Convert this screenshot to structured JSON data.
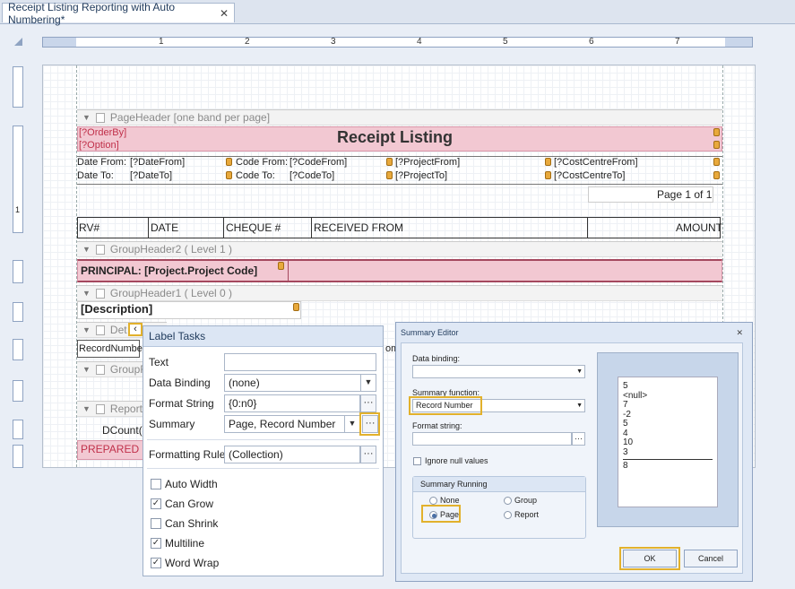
{
  "tab": {
    "title": "Receipt Listing Reporting with Auto Numbering*",
    "close": "✕"
  },
  "ruler": {
    "numbers": [
      "1",
      "2",
      "3",
      "4",
      "5",
      "6",
      "7"
    ],
    "vertical_number": "1"
  },
  "report": {
    "page_header_band": "PageHeader [one band per page]",
    "order_by": "[?OrderBy]",
    "option": "[?Option]",
    "title": "Receipt Listing",
    "date_from_label": "Date From:",
    "date_from_value": "[?DateFrom]",
    "code_from_label": "Code From:",
    "code_from_value": "[?CodeFrom]",
    "project_from": "[?ProjectFrom]",
    "cost_centre_from": "[?CostCentreFrom]",
    "date_to_label": "Date To:",
    "date_to_value": "[?DateTo]",
    "code_to_label": "Code To:",
    "code_to_value": "[?CodeTo]",
    "project_to": "[?ProjectTo]",
    "cost_centre_to": "[?CostCentreTo]",
    "page_of": "Page 1 of 1",
    "columns": [
      "RV#",
      "DATE",
      "CHEQUE #",
      "RECEIVED FROM",
      "AMOUNT"
    ],
    "group_header2_band": "GroupHeader2 ( Level 1 )",
    "principal": "PRINCIPAL: [Project.Project Code]",
    "group_header1_band": "GroupHeader1 ( Level 0 )",
    "description": "[Description]",
    "detail_band": "Det",
    "record_number": "RecordNumbe",
    "om_fragment": "om",
    "group_footer_band": "GroupF",
    "report_footer_band": "ReportF",
    "dcount": "DCount(",
    "prepared_by": "PREPARED B"
  },
  "label_tasks": {
    "title": "Label Tasks",
    "text_label": "Text",
    "text_value": "",
    "data_binding_label": "Data Binding",
    "data_binding_value": "(none)",
    "format_string_label": "Format String",
    "format_string_value": "{0:n0}",
    "summary_label": "Summary",
    "summary_value": "Page, Record Number",
    "formatting_rules_label": "Formatting Rules",
    "formatting_rules_value": "(Collection)",
    "ellipsis": "···",
    "collapse_glyph": "‹",
    "checkboxes": [
      {
        "label": "Auto Width",
        "checked": false
      },
      {
        "label": "Can Grow",
        "checked": true
      },
      {
        "label": "Can Shrink",
        "checked": false
      },
      {
        "label": "Multiline",
        "checked": true
      },
      {
        "label": "Word Wrap",
        "checked": true
      }
    ]
  },
  "summary_editor": {
    "title": "Summary Editor",
    "close": "✕",
    "data_binding_label": "Data binding:",
    "data_binding_value": "",
    "summary_function_label": "Summary function:",
    "summary_function_value": "Record Number",
    "format_string_label": "Format string:",
    "format_string_value": "",
    "ignore_null_label": "Ignore null values",
    "summary_running_label": "Summary Running",
    "running_options": [
      "None",
      "Group",
      "Page",
      "Report"
    ],
    "running_selected": "Page",
    "preview_values": [
      "5",
      "<null>",
      "7",
      "-2",
      "5",
      "4",
      "10",
      "3"
    ],
    "preview_result": "8",
    "ok_label": "OK",
    "cancel_label": "Cancel"
  },
  "colors": {
    "accent_highlight": "#e2b12c",
    "band_pink": "#f2c8d2",
    "panel_header": "#dce6f4"
  }
}
